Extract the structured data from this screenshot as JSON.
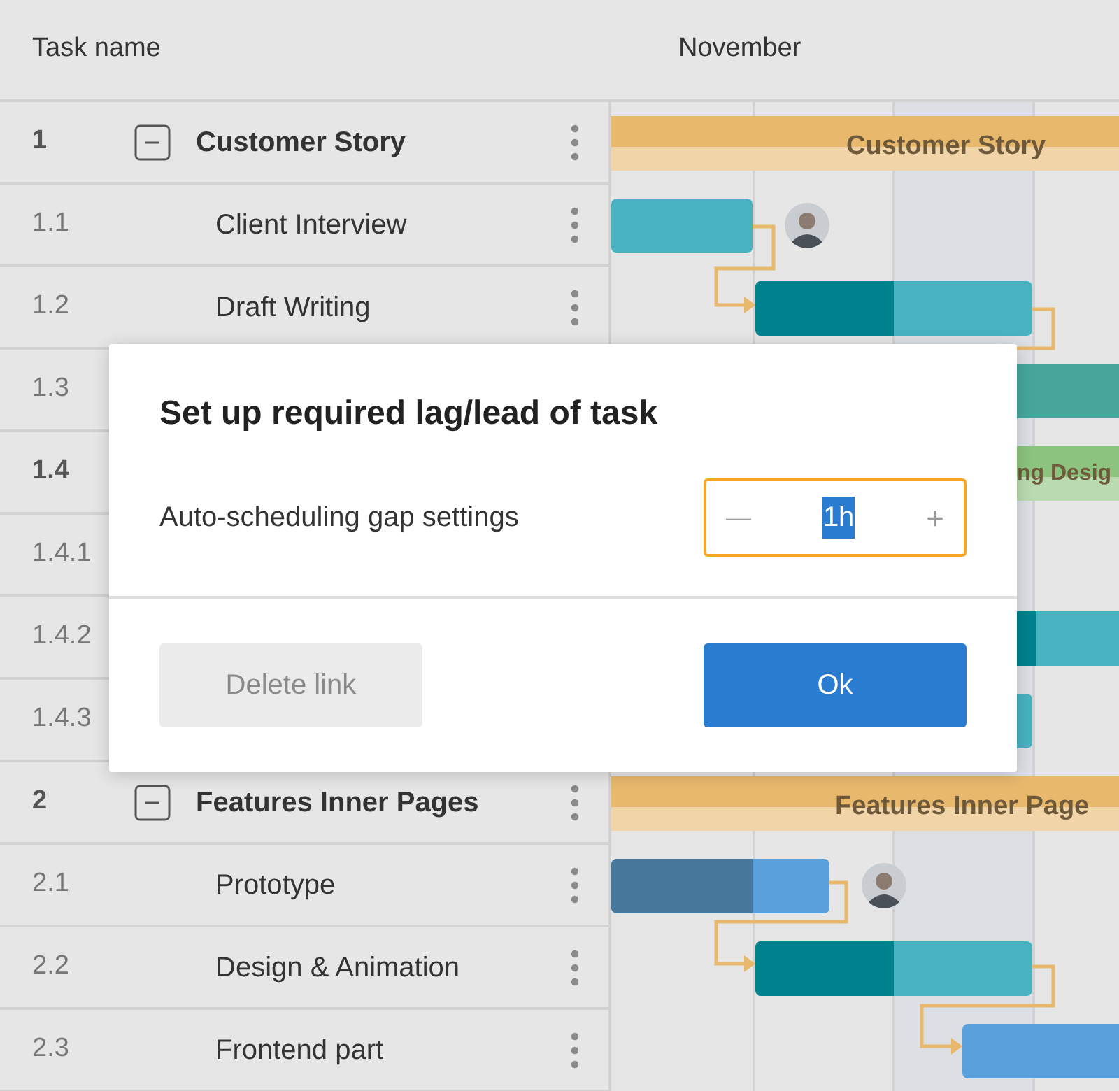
{
  "grid": {
    "columns": [
      "Task name"
    ],
    "rows": [
      {
        "number": "1",
        "kind": "parent",
        "expanded": true,
        "name": "Customer Story",
        "bar": {
          "kind": "summary",
          "color": "#e8b86d",
          "label": "Customer Story"
        }
      },
      {
        "number": "1.1",
        "kind": "task",
        "name": "Client Interview",
        "bar": {
          "kind": "task",
          "color": "#48b2c1",
          "avatar": true
        }
      },
      {
        "number": "1.2",
        "kind": "task",
        "name": "Draft Writing",
        "bar": {
          "kind": "task",
          "color": "#48b2c1",
          "level": 0.5
        }
      },
      {
        "number": "1.3",
        "kind": "task",
        "bar": {
          "kind": "task",
          "color": "#47a69b"
        }
      },
      {
        "number": "1.4",
        "kind": "parent",
        "bar": {
          "kind": "summary",
          "color": "#8cc37f",
          "label": "ng Desig"
        }
      },
      {
        "number": "1.4.1",
        "kind": "task"
      },
      {
        "number": "1.4.2",
        "kind": "task",
        "bar": {
          "kind": "task",
          "color": "#48b2c1",
          "level": 0.67
        }
      },
      {
        "number": "1.4.3",
        "kind": "task",
        "bar": {
          "kind": "task",
          "color": "#48b2c1"
        }
      },
      {
        "number": "2",
        "kind": "parent",
        "expanded": true,
        "name": "Features Inner Pages",
        "bar": {
          "kind": "summary",
          "color": "#e8b86d",
          "label": "Features Inner Page"
        }
      },
      {
        "number": "2.1",
        "kind": "task",
        "name": "Prototype",
        "bar": {
          "kind": "task",
          "color": "#5aa0dc",
          "level": 0.65,
          "avatar": true
        }
      },
      {
        "number": "2.2",
        "kind": "task",
        "name": "Design & Animation",
        "bar": {
          "kind": "task",
          "color": "#48b2c1",
          "level": 0.5
        }
      },
      {
        "number": "2.3",
        "kind": "task",
        "name": "Frontend part",
        "bar": {
          "kind": "task",
          "color": "#5aa0dc"
        }
      }
    ]
  },
  "timeline": {
    "month": "November"
  },
  "dialog": {
    "title": "Set up required lag/lead of task",
    "field_label": "Auto-scheduling gap settings",
    "stepper": {
      "minus": "—",
      "value": "1h",
      "plus": "+",
      "focused": true
    },
    "buttons": [
      {
        "label": "Delete link",
        "kind": "secondary",
        "disabled": true
      },
      {
        "label": "Ok",
        "kind": "primary",
        "disabled": false
      }
    ]
  }
}
